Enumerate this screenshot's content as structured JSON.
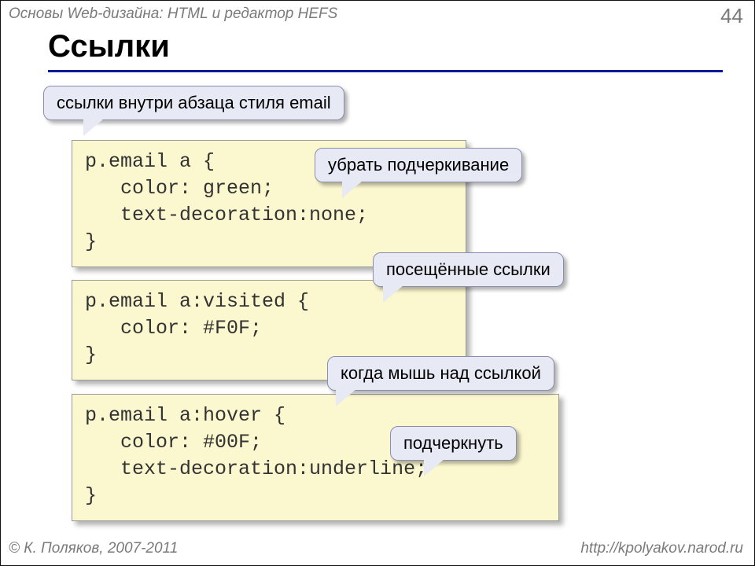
{
  "header": {
    "subtitle": "Основы Web-дизайна: HTML и редактор HEFS",
    "page_num": "44",
    "title": "Ссылки"
  },
  "footer": {
    "left": "© К. Поляков, 2007-2011",
    "right": "http://kpolyakov.narod.ru"
  },
  "code1": "p.email a {\n   color: green;\n   text-decoration:none;\n}",
  "code2": "p.email a:visited {\n   color: #F0F;\n}",
  "code3": "p.email a:hover {\n   color: #00F;\n   text-decoration:underline;\n}",
  "callouts": {
    "c1": "ссылки внутри абзаца стиля email",
    "c2": "убрать подчеркивание",
    "c3": "посещённые ссылки",
    "c4": "когда мышь над ссылкой",
    "c5": "подчеркнуть"
  }
}
